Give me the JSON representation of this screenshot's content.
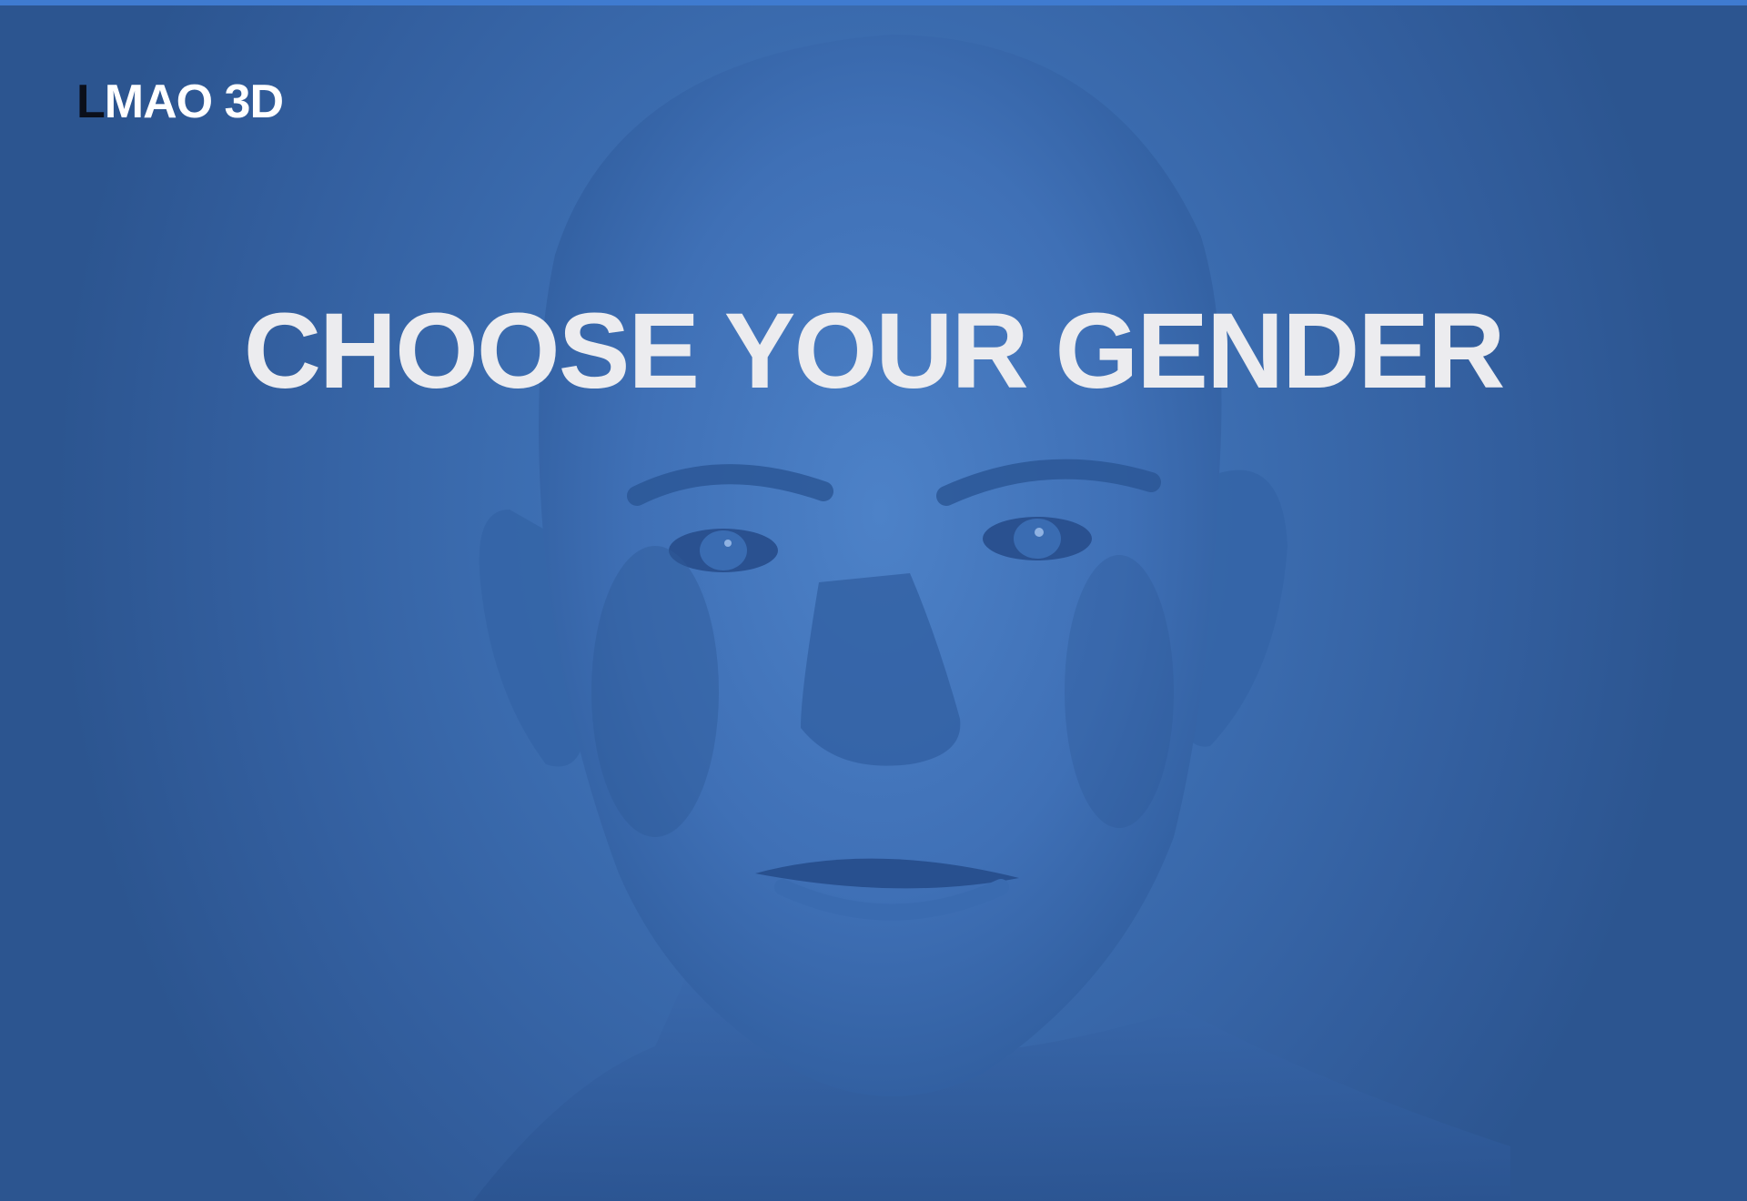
{
  "app": {
    "logo_first_letter": "L",
    "logo_rest": "MAO 3D"
  },
  "screen": {
    "headline": "CHOOSE YOUR GENDER"
  },
  "colors": {
    "background": "#3d6fb3",
    "headline": "#ececef",
    "logo_text": "#ffffff",
    "logo_accent": "#0b0f1a"
  },
  "icons": {
    "background_art": "male-portrait-illustration"
  }
}
